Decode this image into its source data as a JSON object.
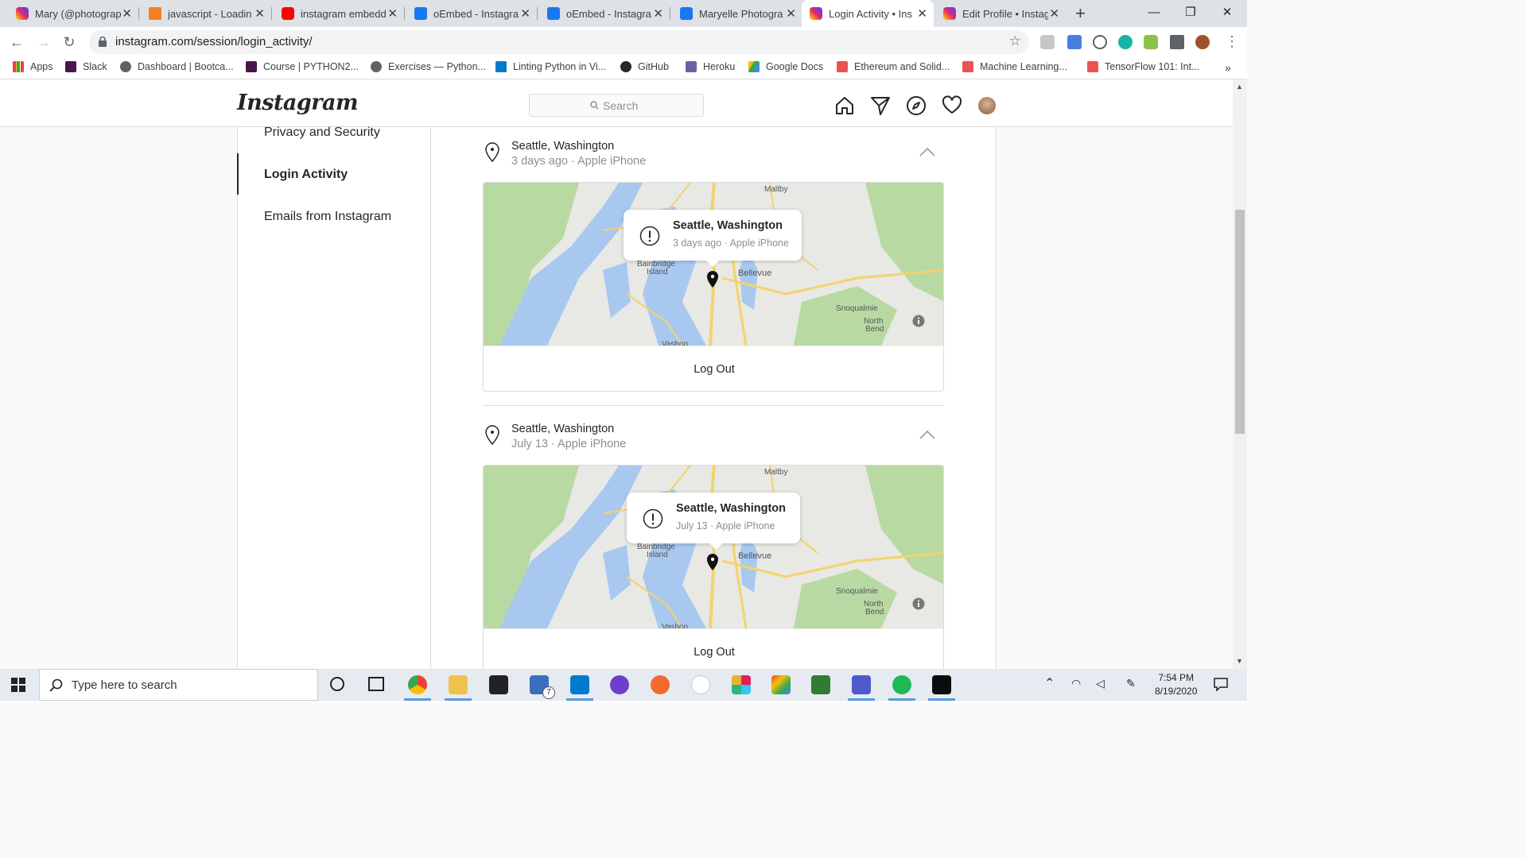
{
  "browser": {
    "tabs": [
      {
        "title": "Mary (@photograp",
        "icon": "instagram-icon",
        "active": false
      },
      {
        "title": "javascript - Loadin",
        "icon": "stackoverflow-icon",
        "active": false
      },
      {
        "title": "instagram embedd",
        "icon": "youtube-icon",
        "active": false
      },
      {
        "title": "oEmbed - Instagra",
        "icon": "facebook-icon",
        "active": false
      },
      {
        "title": "oEmbed - Instagra",
        "icon": "facebook-icon",
        "active": false
      },
      {
        "title": "Maryelle Photogra",
        "icon": "facebook-icon",
        "active": false
      },
      {
        "title": "Login Activity • Ins",
        "icon": "instagram-icon",
        "active": true
      },
      {
        "title": "Edit Profile • Instag",
        "icon": "instagram-icon",
        "active": false
      }
    ],
    "url": "instagram.com/session/login_activity/",
    "bookmarks": [
      {
        "label": "Apps",
        "icon": "apps-grid-icon"
      },
      {
        "label": "Slack",
        "icon": "slack-icon"
      },
      {
        "label": "Dashboard | Bootca...",
        "icon": "globe-icon"
      },
      {
        "label": "Course | PYTHON2...",
        "icon": "w-icon"
      },
      {
        "label": "Exercises — Python...",
        "icon": "globe-icon"
      },
      {
        "label": "Linting Python in Vi...",
        "icon": "vscode-icon"
      },
      {
        "label": "GitHub",
        "icon": "github-icon"
      },
      {
        "label": "Heroku",
        "icon": "heroku-icon"
      },
      {
        "label": "Google Docs",
        "icon": "google-drive-icon"
      },
      {
        "label": "Ethereum and Solid...",
        "icon": "udemy-icon"
      },
      {
        "label": "Machine Learning...",
        "icon": "udemy-icon"
      },
      {
        "label": "TensorFlow 101: Int...",
        "icon": "udemy-icon"
      }
    ],
    "bookmarks_overflow": "»"
  },
  "instagram": {
    "logo": "Instagram",
    "search_placeholder": "Search",
    "sidebar": [
      {
        "label": "Privacy and Security",
        "active": false
      },
      {
        "label": "Login Activity",
        "active": true
      },
      {
        "label": "Emails from Instagram",
        "active": false
      }
    ],
    "logins": [
      {
        "location": "Seattle, Washington",
        "meta": "3 days ago · Apple iPhone",
        "popup_city": "Seattle, Washington",
        "popup_meta": "3 days ago · Apple iPhone",
        "logout_label": "Log Out"
      },
      {
        "location": "Seattle, Washington",
        "meta": "July 13 · Apple iPhone",
        "popup_city": "Seattle, Washington",
        "popup_meta": "July 13 · Apple iPhone",
        "logout_label": "Log Out"
      }
    ],
    "map_labels": {
      "maltby": "Maltby",
      "bainbridge_1": "Bainbridge",
      "bainbridge_2": "Island",
      "bellevue": "Bellevue",
      "snoqualmie": "Snoqualmie",
      "north_1": "North",
      "north_2": "Bend",
      "vashon": "Vashon"
    }
  },
  "taskbar": {
    "search_placeholder": "Type here to search",
    "time": "7:54 PM",
    "date": "8/19/2020",
    "mail_badge": "7"
  },
  "colors": {
    "accent_border": "#dbdbdb",
    "water": "#a8c8f0",
    "park": "#b9d9a3",
    "road": "#f3d36b"
  }
}
